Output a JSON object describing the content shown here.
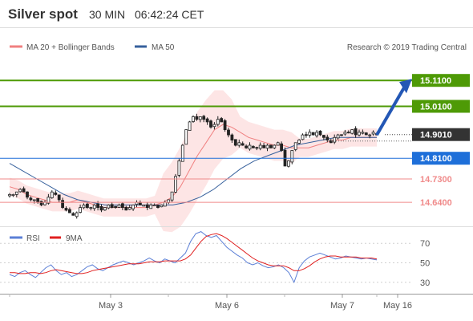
{
  "header": {
    "title": "Silver spot",
    "interval": "30 MIN",
    "time": "06:42:24 CET"
  },
  "legend": {
    "bollinger": "MA 20 + Bollinger Bands",
    "ma50": "MA 50",
    "copyright": "Research © 2019 Trading Central",
    "rsi": "RSI",
    "rsi_ma": "9MA"
  },
  "colors": {
    "bollinger": "#f08080",
    "bollinger_fill": "#fde0e0",
    "ma50": "#36609c",
    "green_level": "#4e9a06",
    "blue_level": "#1e6fd9",
    "pink_level": "#f08a8a",
    "current": "#333333",
    "rsi": "#5b7fd6",
    "rsi_ma": "#e02020",
    "arrow": "#2357b5"
  },
  "chart_data": [
    {
      "type": "candlestick",
      "title": "Silver spot",
      "x_tick_labels": [
        "May 3",
        "May 6",
        "May 7",
        "May 16"
      ],
      "ylim": [
        14.56,
        15.16
      ],
      "levels": [
        {
          "value": 15.11,
          "label": "15.1100",
          "kind": "resistance",
          "color": "#4e9a06"
        },
        {
          "value": 15.01,
          "label": "15.0100",
          "kind": "resistance",
          "color": "#4e9a06"
        },
        {
          "value": 14.901,
          "label": "14.9010",
          "kind": "current",
          "color": "#333333"
        },
        {
          "value": 14.81,
          "label": "14.8100",
          "kind": "pivot",
          "color": "#1e6fd9"
        },
        {
          "value": 14.73,
          "label": "14.7300",
          "kind": "support",
          "color": "#f08a8a"
        },
        {
          "value": 14.64,
          "label": "14.6400",
          "kind": "support",
          "color": "#f08a8a"
        }
      ],
      "close_path": [
        14.67,
        14.67,
        14.68,
        14.69,
        14.68,
        14.66,
        14.65,
        14.65,
        14.64,
        14.63,
        14.64,
        14.66,
        14.68,
        14.67,
        14.65,
        14.62,
        14.61,
        14.6,
        14.59,
        14.6,
        14.62,
        14.63,
        14.62,
        14.62,
        14.63,
        14.62,
        14.61,
        14.62,
        14.63,
        14.62,
        14.62,
        14.63,
        14.62,
        14.61,
        14.62,
        14.63,
        14.64,
        14.63,
        14.63,
        14.62,
        14.63,
        14.63,
        14.62,
        14.63,
        14.64,
        14.65,
        14.68,
        14.74,
        14.8,
        14.86,
        14.92,
        14.95,
        14.97,
        14.96,
        14.97,
        14.96,
        14.95,
        14.93,
        14.94,
        14.96,
        14.95,
        14.92,
        14.9,
        14.88,
        14.86,
        14.87,
        14.86,
        14.85,
        14.86,
        14.85,
        14.85,
        14.86,
        14.85,
        14.86,
        14.85,
        14.86,
        14.87,
        14.84,
        14.78,
        14.8,
        14.84,
        14.87,
        14.88,
        14.9,
        14.9,
        14.91,
        14.9,
        14.91,
        14.9,
        14.89,
        14.88,
        14.87,
        14.89,
        14.9,
        14.9,
        14.91,
        14.91,
        14.92,
        14.9,
        14.91,
        14.91,
        14.9,
        14.9,
        14.91,
        14.9
      ],
      "ma20_path": [
        14.7,
        14.69,
        14.67,
        14.66,
        14.65,
        14.64,
        14.64,
        14.64,
        14.65,
        14.64,
        14.63,
        14.62,
        14.62,
        14.62,
        14.62,
        14.62,
        14.62,
        14.63,
        14.64,
        14.66,
        14.7,
        14.76,
        14.82,
        14.87,
        14.92,
        14.94,
        14.93,
        14.91,
        14.89,
        14.88,
        14.87,
        14.86,
        14.86,
        14.85,
        14.85,
        14.85,
        14.86,
        14.87,
        14.88,
        14.88,
        14.89,
        14.89,
        14.89,
        14.89
      ],
      "ma50_path": [
        14.79,
        14.76,
        14.73,
        14.7,
        14.67,
        14.65,
        14.64,
        14.63,
        14.63,
        14.63,
        14.63,
        14.63,
        14.63,
        14.64,
        14.66,
        14.69,
        14.73,
        14.77,
        14.8,
        14.82,
        14.84,
        14.86,
        14.87,
        14.88,
        14.89,
        14.89,
        14.89,
        14.89
      ],
      "forecast_target": 15.11
    },
    {
      "type": "line",
      "title": "RSI",
      "y_ticks": [
        30,
        50,
        70
      ],
      "ylim": [
        20,
        85
      ],
      "series": [
        {
          "name": "RSI",
          "values": [
            38,
            36,
            40,
            42,
            38,
            35,
            40,
            45,
            48,
            42,
            38,
            40,
            36,
            38,
            42,
            46,
            48,
            44,
            42,
            45,
            48,
            50,
            52,
            50,
            48,
            50,
            52,
            55,
            52,
            50,
            54,
            52,
            50,
            55,
            60,
            72,
            80,
            82,
            78,
            76,
            78,
            72,
            66,
            62,
            58,
            55,
            50,
            48,
            50,
            47,
            45,
            46,
            48,
            45,
            40,
            30,
            45,
            52,
            56,
            58,
            60,
            58,
            56,
            54,
            55,
            57,
            56,
            55,
            54,
            55,
            54,
            53
          ]
        },
        {
          "name": "9MA",
          "values": [
            40,
            40,
            39,
            39,
            40,
            40,
            39,
            40,
            42,
            43,
            42,
            41,
            40,
            39,
            39,
            40,
            42,
            43,
            44,
            45,
            46,
            47,
            48,
            49,
            49,
            49,
            50,
            51,
            51,
            51,
            52,
            52,
            52,
            52,
            54,
            58,
            65,
            72,
            77,
            79,
            80,
            78,
            75,
            71,
            67,
            63,
            59,
            55,
            52,
            50,
            48,
            47,
            47,
            47,
            45,
            42,
            42,
            44,
            47,
            51,
            54,
            56,
            57,
            57,
            56,
            56,
            56,
            56,
            55,
            55,
            55,
            54
          ]
        }
      ]
    }
  ]
}
